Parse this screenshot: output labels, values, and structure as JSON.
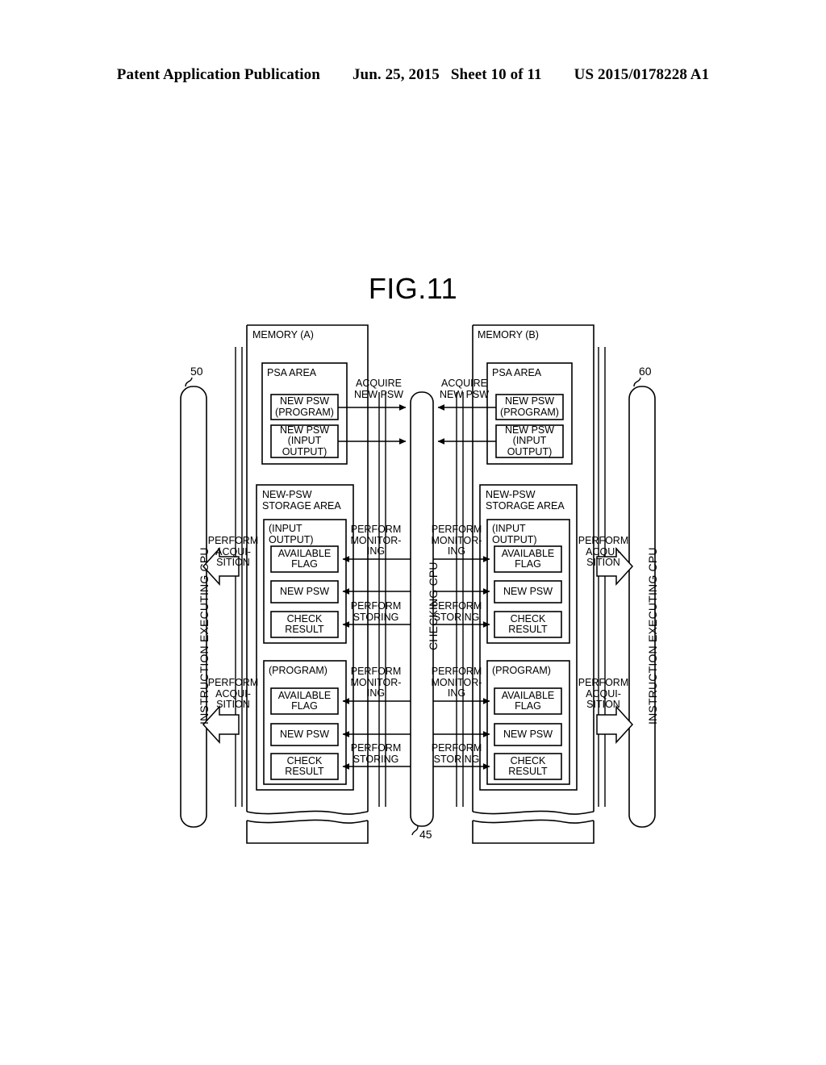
{
  "header": {
    "publication": "Patent Application Publication",
    "date": "Jun. 25, 2015",
    "sheet": "Sheet 10 of 11",
    "number": "US 2015/0178228 A1"
  },
  "figure": {
    "title": "FIG.11"
  },
  "diagram": {
    "left_cpu": {
      "label": "INSTRUCTION EXECUTING CPU",
      "ref": "50"
    },
    "right_cpu": {
      "label": "INSTRUCTION EXECUTING CPU",
      "ref": "60"
    },
    "checking_cpu": {
      "label": "CHECKING CPU",
      "ref": "45"
    },
    "memory_a": {
      "title": "MEMORY (A)",
      "psa_area": {
        "title": "PSA AREA",
        "items": [
          "NEW PSW\n(PROGRAM)",
          "NEW PSW\n(INPUT\nOUTPUT)"
        ]
      },
      "storage_area": {
        "title": "NEW-PSW\nSTORAGE AREA",
        "groups": [
          {
            "title": "(INPUT\nOUTPUT)",
            "items": [
              "AVAILABLE\nFLAG",
              "NEW PSW",
              "CHECK\nRESULT"
            ]
          },
          {
            "title": "(PROGRAM)",
            "items": [
              "AVAILABLE\nFLAG",
              "NEW PSW",
              "CHECK\nRESULT"
            ]
          }
        ]
      }
    },
    "memory_b": {
      "title": "MEMORY (B)",
      "psa_area": {
        "title": "PSA AREA",
        "items": [
          "NEW PSW\n(PROGRAM)",
          "NEW PSW\n(INPUT\nOUTPUT)"
        ]
      },
      "storage_area": {
        "title": "NEW-PSW\nSTORAGE AREA",
        "groups": [
          {
            "title": "(INPUT\nOUTPUT)",
            "items": [
              "AVAILABLE\nFLAG",
              "NEW PSW",
              "CHECK\nRESULT"
            ]
          },
          {
            "title": "(PROGRAM)",
            "items": [
              "AVAILABLE\nFLAG",
              "NEW PSW",
              "CHECK\nRESULT"
            ]
          }
        ]
      }
    },
    "flow_labels": {
      "acquire_new_psw_left": "ACQUIRE\nNEW PSW",
      "acquire_new_psw_right": "ACQUIRE\nNEW PSW",
      "perform_monitoring": "PERFORM\nMONITOR-\nING",
      "perform_storing": "PERFORM\nSTORING",
      "perform_acquisition": "PERFORM\nACQUI-\nSITION"
    }
  }
}
